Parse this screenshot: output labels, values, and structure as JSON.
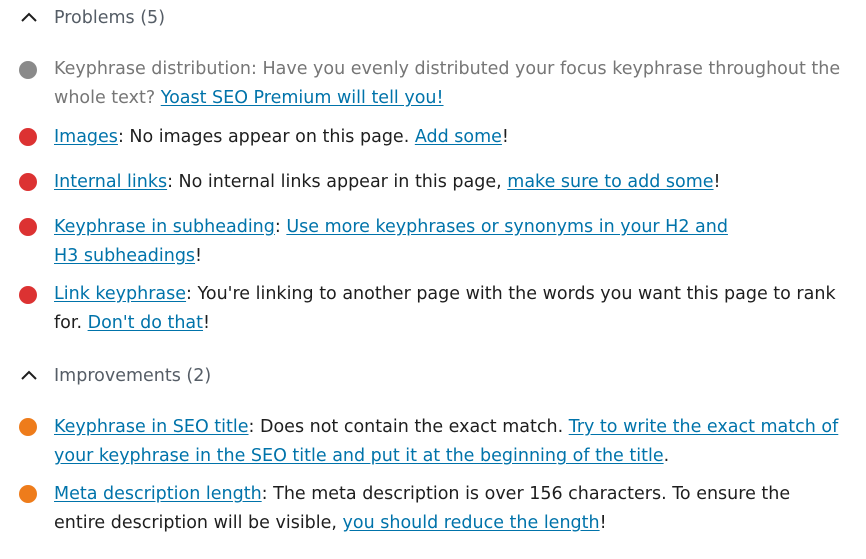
{
  "colors": {
    "neutral": "#8a8a8a",
    "bad": "#dc3232",
    "ok": "#ee7c1b",
    "link": "#0073aa"
  },
  "problems": {
    "title": "Problems (5)",
    "icon": "chevron-up-icon",
    "items": [
      {
        "status": "neutral",
        "lead": "Keyphrase distribution: Have you evenly distributed your focus keyphrase throughout the whole text? ",
        "link": "Yoast SEO Premium will tell you!"
      },
      {
        "status": "bad",
        "name": "Images",
        "text1": ": No images appear on this page. ",
        "link": "Add some",
        "text2": "!"
      },
      {
        "status": "bad",
        "name": "Internal links",
        "text1": ": No internal links appear in this page, ",
        "link": "make sure to add some",
        "text2": "!"
      },
      {
        "status": "bad",
        "name": "Keyphrase in subheading",
        "text1": ": ",
        "link": "Use more keyphrases or synonyms in your H2 and H3 subheadings",
        "text2": "!"
      },
      {
        "status": "bad",
        "name": "Link keyphrase",
        "text1": ": You're linking to another page with the words you want this page to rank for. ",
        "link": "Don't do that",
        "text2": "!"
      }
    ]
  },
  "improvements": {
    "title": "Improvements (2)",
    "icon": "chevron-up-icon",
    "items": [
      {
        "status": "ok",
        "name": "Keyphrase in SEO title",
        "text1": ": Does not contain the exact match. ",
        "link": "Try to write the exact match of your keyphrase in the SEO title and put it at the beginning of the title",
        "text2": "."
      },
      {
        "status": "ok",
        "name": "Meta description length",
        "text1": ": The meta description is over 156 characters. To ensure the entire description will be visible, ",
        "link": "you should reduce the length",
        "text2": "!"
      }
    ]
  }
}
